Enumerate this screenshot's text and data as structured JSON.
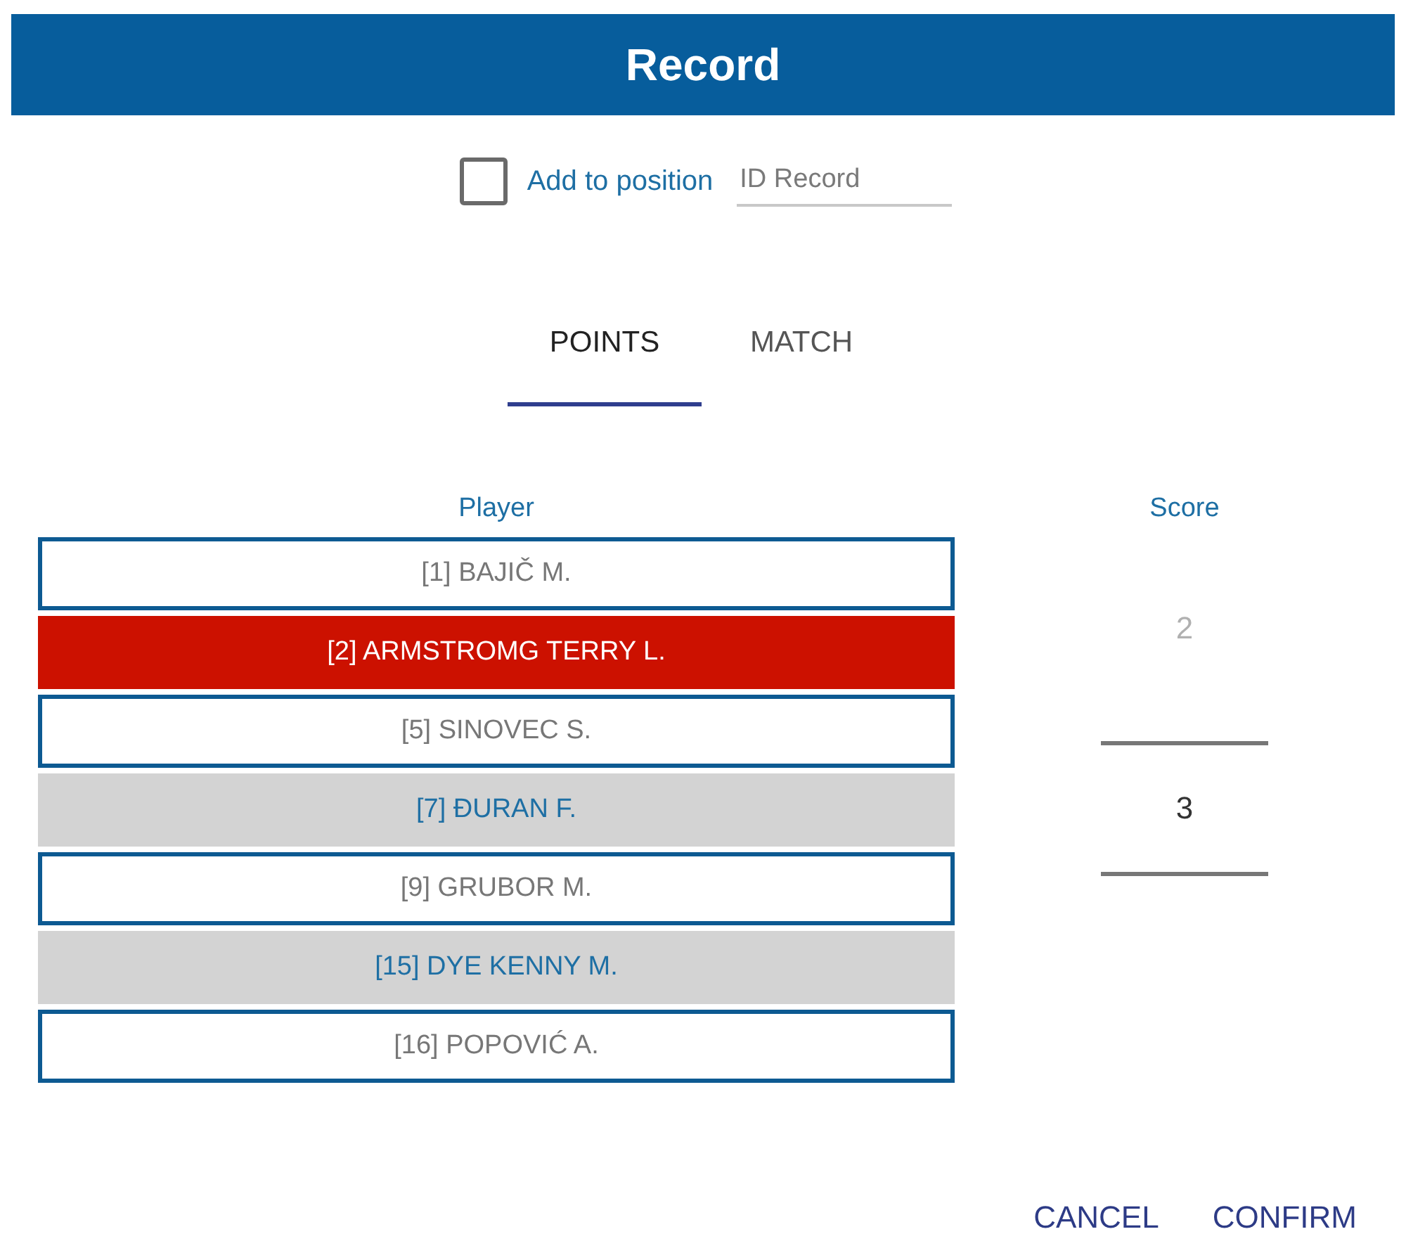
{
  "dialog": {
    "title": "Record"
  },
  "add_to_position": {
    "label": "Add to position",
    "checked": false
  },
  "id_field": {
    "placeholder": "ID Record"
  },
  "tabs": [
    {
      "label": "POINTS",
      "selected": true
    },
    {
      "label": "MATCH",
      "selected": false
    }
  ],
  "players": {
    "header": "Player",
    "rows": [
      {
        "label": "[1] BAJIČ M.",
        "selected": false,
        "shaded": false
      },
      {
        "label": "[2] ARMSTROMG TERRY L.",
        "selected": true,
        "shaded": false
      },
      {
        "label": "[5] SINOVEC S.",
        "selected": false,
        "shaded": false
      },
      {
        "label": "[7] ĐURAN F.",
        "selected": false,
        "shaded": true
      },
      {
        "label": "[9] GRUBOR M.",
        "selected": false,
        "shaded": false
      },
      {
        "label": "[15] DYE KENNY M.",
        "selected": false,
        "shaded": true
      },
      {
        "label": "[16] POPOVIĆ A.",
        "selected": false,
        "shaded": false
      }
    ]
  },
  "score": {
    "header": "Score",
    "items": [
      {
        "label": "2",
        "selected": false
      },
      {
        "label": "3",
        "selected": true
      }
    ]
  },
  "buttons": [
    {
      "label": "CANCEL"
    },
    {
      "label": "CONFIRM"
    }
  ]
}
